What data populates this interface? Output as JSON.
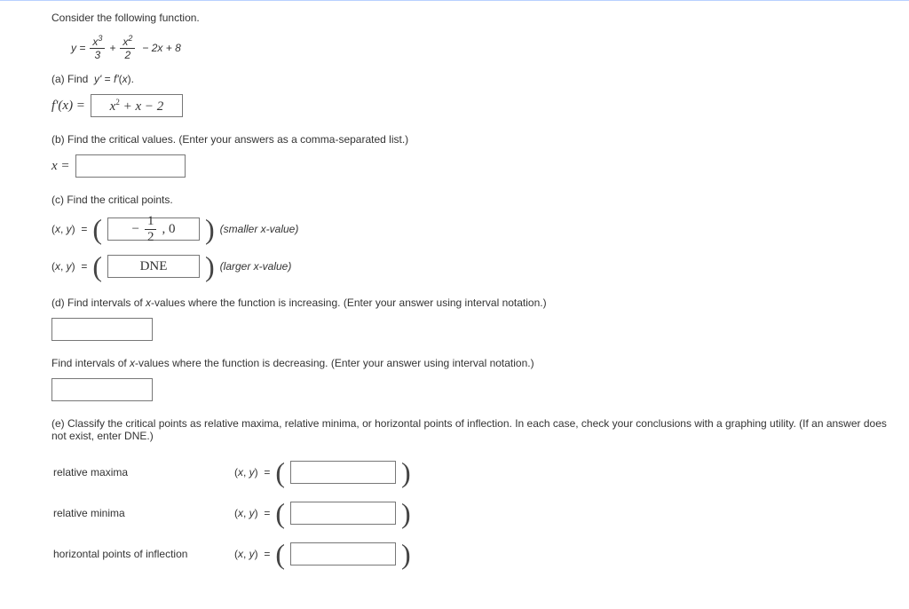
{
  "intro": "Consider the following function.",
  "equation": {
    "y_eq": "y =",
    "frac1_num": "x³",
    "frac1_den": "3",
    "plus": "+",
    "frac2_num": "x²",
    "frac2_den": "2",
    "tail": "− 2x + 8"
  },
  "a": {
    "label": "(a) Find  y' = f'(x).",
    "lhs": "f'(x) =",
    "answer": "x² + x − 2"
  },
  "b": {
    "label": "(b) Find the critical values. (Enter your answers as a comma-separated list.)",
    "lhs": "x ="
  },
  "c": {
    "label": "(c) Find the critical points.",
    "xy": "(x, y)  =",
    "ans1": "− ½ , 0",
    "hint1": "(smaller x-value)",
    "ans2": "DNE",
    "hint2": "(larger x-value)"
  },
  "d": {
    "label": "(d) Find intervals of x-values where the function is increasing. (Enter your answer using interval notation.)",
    "label2": "Find intervals of x-values where the function is decreasing. (Enter your answer using interval notation.)"
  },
  "e": {
    "label": "(e) Classify the critical points as relative maxima, relative minima, or horizontal points of inflection. In each case, check your conclusions with a graphing utility. (If an answer does not exist, enter DNE.)",
    "r1": "relative maxima",
    "r2": "relative minima",
    "r3": "horizontal points of inflection",
    "xy": "(x, y)  ="
  }
}
